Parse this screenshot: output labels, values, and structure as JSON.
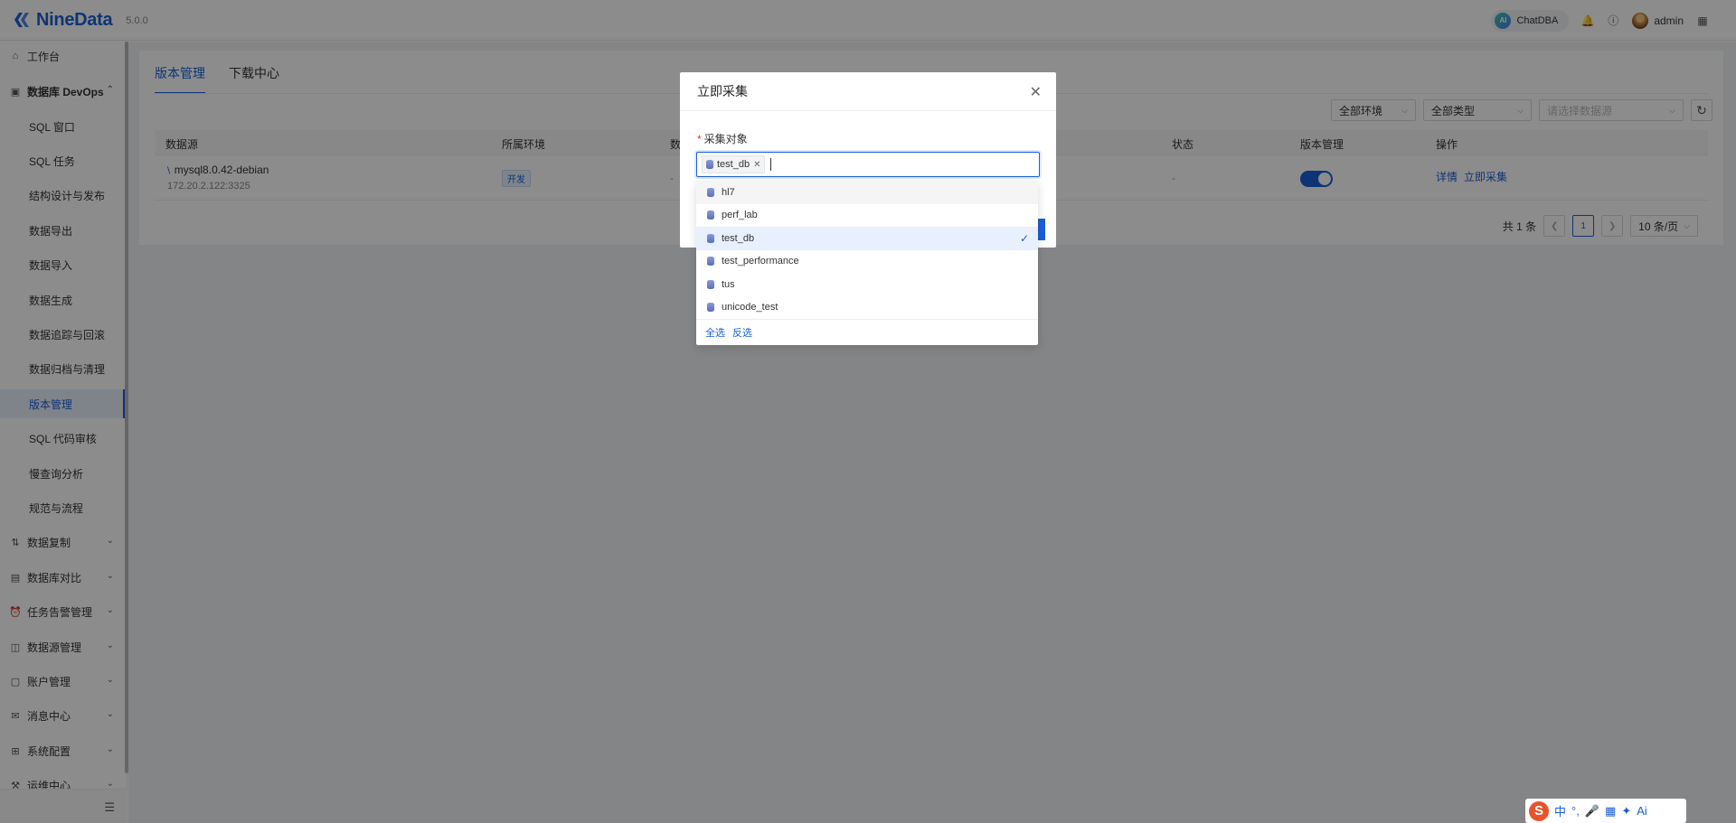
{
  "header": {
    "logo_text": "NineData",
    "version": "5.0.0",
    "chatdba_label": "ChatDBA",
    "chatdba_badge": "AI",
    "user_name": "admin"
  },
  "sidebar": {
    "items": [
      {
        "label": "工作台",
        "top": 0
      },
      {
        "label": "数据库 DevOps"
      },
      {
        "label": "SQL 窗口"
      },
      {
        "label": "SQL 任务"
      },
      {
        "label": "结构设计与发布"
      },
      {
        "label": "数据导出"
      },
      {
        "label": "数据导入"
      },
      {
        "label": "数据生成"
      },
      {
        "label": "数据追踪与回滚"
      },
      {
        "label": "数据归档与清理"
      },
      {
        "label": "版本管理"
      },
      {
        "label": "SQL 代码审核"
      },
      {
        "label": "慢查询分析"
      },
      {
        "label": "规范与流程"
      },
      {
        "label": "数据复制"
      },
      {
        "label": "数据库对比"
      },
      {
        "label": "任务告警管理"
      },
      {
        "label": "数据源管理"
      },
      {
        "label": "账户管理"
      },
      {
        "label": "消息中心"
      },
      {
        "label": "系统配置"
      },
      {
        "label": "运维中心"
      }
    ]
  },
  "main": {
    "tabs": [
      "版本管理",
      "下载中心"
    ],
    "filters": {
      "env": "全部环境",
      "type": "全部类型",
      "datasource_placeholder": "请选择数据源"
    },
    "table": {
      "headers": [
        "数据源",
        "所属环境",
        "数",
        "状态",
        "版本管理",
        "操作"
      ],
      "rows": [
        {
          "name": "mysql8.0.42-debian",
          "addr": "172.20.2.122:3325",
          "env": "开发",
          "env_partial": "-",
          "status": "-",
          "actions": [
            "详情",
            "立即采集"
          ]
        }
      ]
    },
    "pager": {
      "total": "共 1 条",
      "page": "1",
      "size": "10 条/页"
    }
  },
  "modal": {
    "title": "立即采集",
    "field_label": "采集对象",
    "selected_tag": "test_db",
    "options": [
      "hl7",
      "perf_lab",
      "test_db",
      "test_performance",
      "tus",
      "unicode_test"
    ],
    "footer_select_all": "全选",
    "footer_invert": "反选"
  },
  "ime": {
    "items": [
      "中",
      "°,",
      "🎤",
      "▦",
      "✦",
      "Ai"
    ]
  },
  "colors": {
    "primary": "#1b5fd6",
    "mask": "rgba(0,0,0,0.45)",
    "page_bg": "#f0f2f5"
  }
}
